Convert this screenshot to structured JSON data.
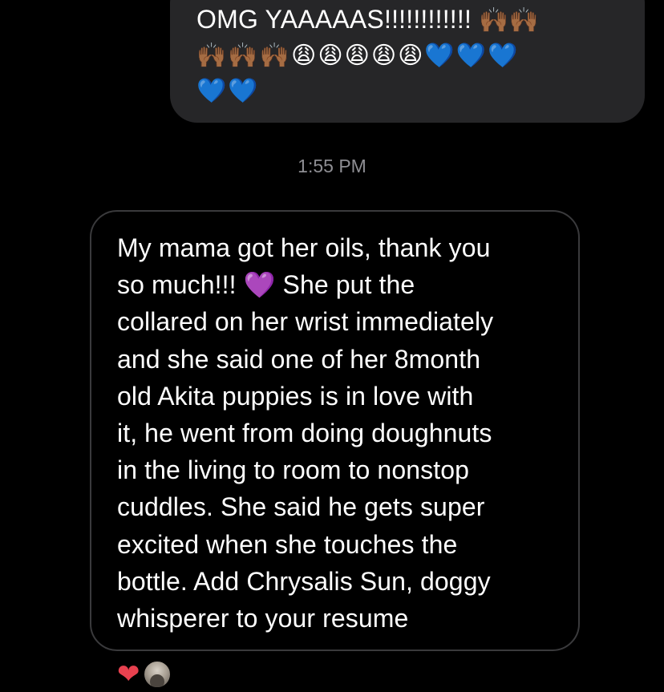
{
  "sent_message": {
    "text_line1": "OMG YAAAAAS!!!!!!!!!!!! ",
    "emoji_line1": "🙌🏾🙌🏾",
    "emoji_line2": "🙌🏾🙌🏾🙌🏾😩😩😩😩😩💙💙💙",
    "emoji_line3": "💙💙"
  },
  "timestamp": "1:55 PM",
  "received_message": {
    "lines": [
      "My mama got her oils, thank you",
      "so much!!!  💜  She put the",
      "collared on her wrist immediately",
      "and she said one of  her 8month",
      "old Akita puppies is in love with",
      "it, he went from doing doughnuts",
      "in the living to room to  nonstop",
      "cuddles. She said he gets super",
      "excited when she touches the",
      "bottle. Add Chrysalis Sun,  doggy",
      "whisperer to your resume"
    ]
  },
  "reaction": {
    "emoji": "❤",
    "color": "#e8414f"
  },
  "colors": {
    "background": "#000000",
    "sent_bubble": "#262628",
    "received_border": "#3a3a3c",
    "timestamp": "#8e8e93"
  }
}
